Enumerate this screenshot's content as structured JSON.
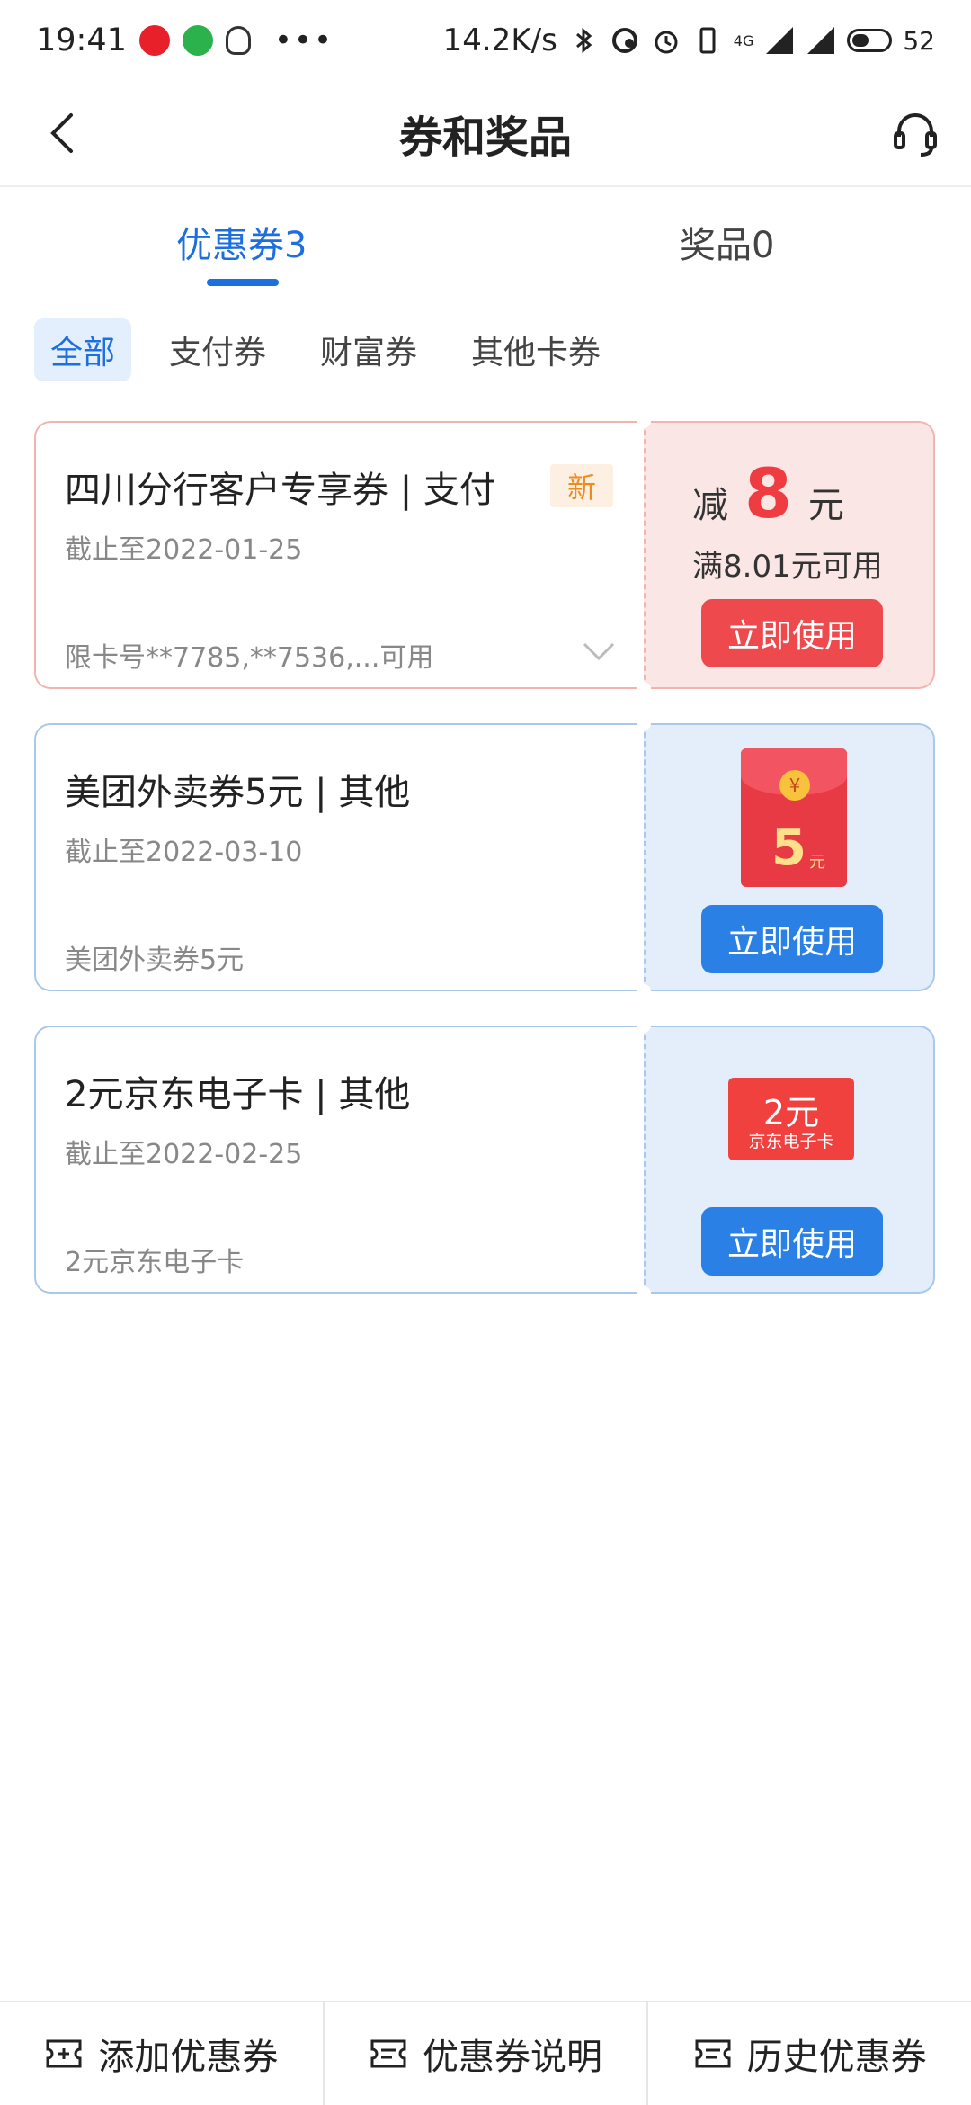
{
  "status_bar": {
    "time": "19:41",
    "speed": "14.2K/s",
    "network": "4G",
    "battery": "52"
  },
  "header": {
    "title": "券和奖品"
  },
  "tabs": [
    {
      "label": "优惠券3",
      "active": true
    },
    {
      "label": "奖品0",
      "active": false
    }
  ],
  "filters": [
    {
      "label": "全部",
      "active": true
    },
    {
      "label": "支付券",
      "active": false
    },
    {
      "label": "财富券",
      "active": false
    },
    {
      "label": "其他卡券",
      "active": false
    }
  ],
  "coupons": [
    {
      "title": "四川分行客户专享券 | 支付",
      "badge": "新",
      "expiry": "截止至2022-01-25",
      "desc": "限卡号**7785,**7536,...可用",
      "amount_prefix": "减",
      "amount": "8",
      "amount_unit": "元",
      "condition": "满8.01元可用",
      "button": "立即使用"
    },
    {
      "title": "美团外卖券5元 | 其他",
      "expiry": "截止至2022-03-10",
      "desc": "美团外卖券5元",
      "icon_amount": "5",
      "icon_unit": "元",
      "button": "立即使用"
    },
    {
      "title": "2元京东电子卡 | 其他",
      "expiry": "截止至2022-02-25",
      "desc": "2元京东电子卡",
      "icon_amount": "2元",
      "icon_label": "京东电子卡",
      "button": "立即使用"
    }
  ],
  "bottom_bar": [
    {
      "label": "添加优惠券",
      "icon": "ticket-add-icon"
    },
    {
      "label": "优惠券说明",
      "icon": "ticket-info-icon"
    },
    {
      "label": "历史优惠券",
      "icon": "ticket-history-icon"
    }
  ],
  "colors": {
    "accent_blue": "#1d6fe0",
    "button_blue": "#2b80e6",
    "button_red": "#ee4a4e",
    "card_pink_bg": "#fbe6e6",
    "card_pink_border": "#f3b4b0",
    "card_blue_bg": "#e4eefb",
    "card_blue_border": "#a9c8ea"
  }
}
